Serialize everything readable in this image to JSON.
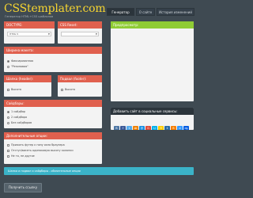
{
  "header": {
    "logo": "CSStemplater.com",
    "tagline": "Генератор HTML+CSS шаблонов",
    "nav": [
      "Генератор",
      "О сайте",
      "История изменений"
    ]
  },
  "doctype": {
    "title": "DOCTYPE:",
    "value": "HTML 5"
  },
  "css_reset": {
    "title": "CSS Reset:",
    "value": ""
  },
  "preview": {
    "title": "Предпросмотр:"
  },
  "width": {
    "title": "Ширина макета:",
    "options": [
      "Фиксированная",
      "\"Резиновая\""
    ]
  },
  "header_height": {
    "title": "Шапка (header):",
    "option": "Высота"
  },
  "footer": {
    "title": "Подвал (footer):",
    "option": "Высота"
  },
  "sidebars": {
    "title": "Сайдбары:",
    "options": [
      "1 сайдбар",
      "2 сайдбара",
      "Без сайдбаров"
    ]
  },
  "extra": {
    "title": "Дополнительные опции:",
    "options": [
      "Прижать футер к низу окна браузера",
      "Отступ/висеть одинаковую высоту колонки",
      "Не то, не другое"
    ]
  },
  "social": {
    "title": "Добавить сайт в социальные сервисы:",
    "icons": [
      {
        "icon": "vk-icon",
        "glyph": "B",
        "color": "#4c75a3"
      },
      {
        "icon": "facebook-icon",
        "glyph": "f",
        "color": "#3b5998"
      },
      {
        "icon": "twitter-icon",
        "glyph": "t",
        "color": "#55acee"
      },
      {
        "icon": "odnoklassniki-icon",
        "glyph": "ok",
        "color": "#ee8208"
      },
      {
        "icon": "mailru-icon",
        "glyph": "@",
        "color": "#168de2"
      },
      {
        "icon": "google-icon",
        "glyph": "G",
        "color": "#dd4b39"
      },
      {
        "icon": "livejournal-icon",
        "glyph": "LJ",
        "color": "#00b0ea"
      },
      {
        "icon": "yandex-icon",
        "glyph": "Я",
        "color": "#ffcc00"
      },
      {
        "icon": "liveinternet-icon",
        "glyph": "li",
        "color": "#2b6ca3"
      },
      {
        "icon": "blogger-icon",
        "glyph": "B",
        "color": "#f57d00"
      },
      {
        "icon": "delicious-icon",
        "glyph": "d",
        "color": "#3399ff"
      },
      {
        "icon": "digg-icon",
        "glyph": "dg",
        "color": "#005be2"
      },
      {
        "icon": "moikrug-icon",
        "glyph": "мк",
        "color": "#5a5a5a"
      },
      {
        "icon": "bobrdobr-icon",
        "glyph": "bd",
        "color": "#8a6d3b"
      },
      {
        "icon": "memori-icon",
        "glyph": "m",
        "color": "#cc3333"
      },
      {
        "icon": "linkedin-icon",
        "glyph": "in",
        "color": "#0077b5"
      },
      {
        "icon": "rss-icon",
        "glyph": "rs",
        "color": "#f26522"
      },
      {
        "icon": "stumble-icon",
        "glyph": "su",
        "color": "#eb4924"
      },
      {
        "icon": "friendfeed-icon",
        "glyph": "ff",
        "color": "#2f72c4"
      },
      {
        "icon": "news2-icon",
        "glyph": "n2",
        "color": "#7a9e2f"
      },
      {
        "icon": "surfingbird-icon",
        "glyph": "sb",
        "color": "#3fa9f5"
      },
      {
        "icon": "print-icon",
        "glyph": "pr",
        "color": "#777777"
      }
    ]
  },
  "notice": {
    "text": "Шапка и подвал и сайдбары - обязательные опции"
  },
  "get_link": {
    "label": "Получить ссылку"
  }
}
